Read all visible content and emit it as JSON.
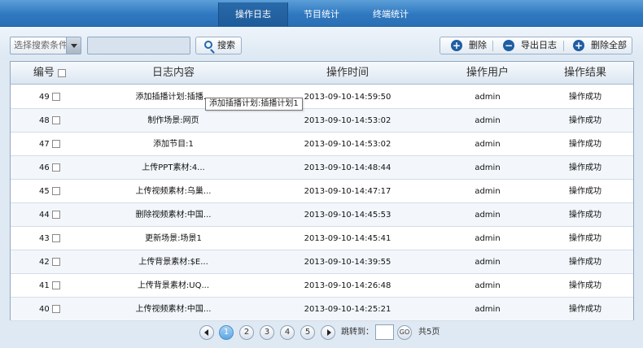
{
  "tabs": [
    {
      "label": "操作日志",
      "active": true
    },
    {
      "label": "节目统计",
      "active": false
    },
    {
      "label": "终端统计",
      "active": false
    }
  ],
  "toolbar": {
    "select_label": "选择搜索条件",
    "search_value": "",
    "search_button": "搜索",
    "actions": {
      "delete": "删除",
      "export": "导出日志",
      "delete_all": "删除全部"
    }
  },
  "table": {
    "headers": {
      "id": "编号",
      "content": "日志内容",
      "time": "操作时间",
      "user": "操作用户",
      "result": "操作结果"
    },
    "rows": [
      {
        "id": "49",
        "content": "添加插播计划:插播...",
        "time": "2013-09-10-14:59:50",
        "user": "admin",
        "result": "操作成功"
      },
      {
        "id": "48",
        "content": "制作场景:网页",
        "time": "2013-09-10-14:53:02",
        "user": "admin",
        "result": "操作成功"
      },
      {
        "id": "47",
        "content": "添加节目:1",
        "time": "2013-09-10-14:53:02",
        "user": "admin",
        "result": "操作成功"
      },
      {
        "id": "46",
        "content": "上传PPT素材:4...",
        "time": "2013-09-10-14:48:44",
        "user": "admin",
        "result": "操作成功"
      },
      {
        "id": "45",
        "content": "上传视频素材:乌巢...",
        "time": "2013-09-10-14:47:17",
        "user": "admin",
        "result": "操作成功"
      },
      {
        "id": "44",
        "content": "删除视频素材:中国...",
        "time": "2013-09-10-14:45:53",
        "user": "admin",
        "result": "操作成功"
      },
      {
        "id": "43",
        "content": "更新场景:场景1",
        "time": "2013-09-10-14:45:41",
        "user": "admin",
        "result": "操作成功"
      },
      {
        "id": "42",
        "content": "上传背景素材:$E...",
        "time": "2013-09-10-14:39:55",
        "user": "admin",
        "result": "操作成功"
      },
      {
        "id": "41",
        "content": "上传背景素材:UQ...",
        "time": "2013-09-10-14:26:48",
        "user": "admin",
        "result": "操作成功"
      },
      {
        "id": "40",
        "content": "上传视频素材:中国...",
        "time": "2013-09-10-14:25:21",
        "user": "admin",
        "result": "操作成功"
      }
    ]
  },
  "tooltip": "添加插播计划:插播计划1",
  "pager": {
    "pages": [
      "1",
      "2",
      "3",
      "4",
      "5"
    ],
    "current": "1",
    "jump_label": "跳转到：",
    "go_label": "GO",
    "total_label": "共5页"
  },
  "colors": {
    "header_blue": "#2f78c0",
    "active_tab": "#1d5b9a",
    "icon_blue": "#1f5ea3"
  }
}
